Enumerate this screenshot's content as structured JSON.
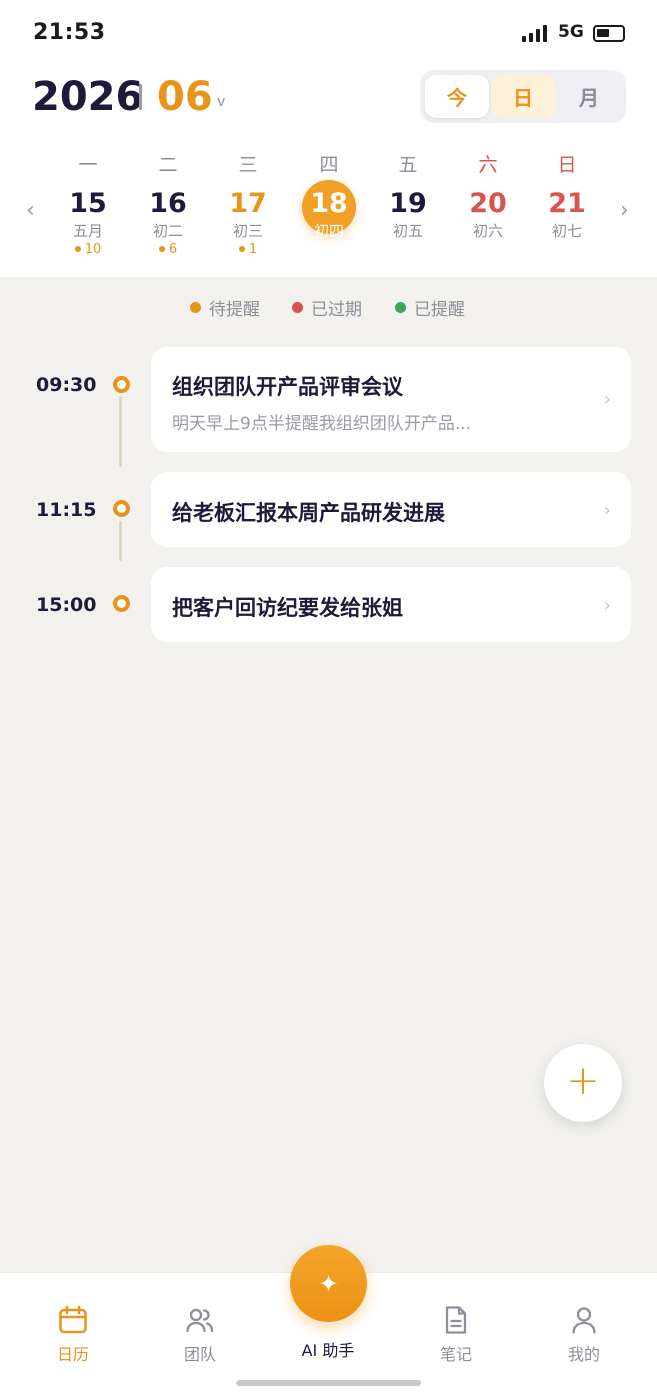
{
  "status_bar": {
    "time": "21:53",
    "network": "5G"
  },
  "header": {
    "year": "2026",
    "month": "06",
    "month_caret": "v",
    "view_options": [
      "今",
      "日",
      "月"
    ],
    "selected_view": "日"
  },
  "week": {
    "prev_arrow": "‹",
    "next_arrow": "›",
    "days": [
      {
        "weekday": "一",
        "date": "15",
        "lunar": "五月",
        "count": "10"
      },
      {
        "weekday": "二",
        "date": "16",
        "lunar": "初二",
        "count": "6"
      },
      {
        "weekday": "三",
        "date": "17",
        "lunar": "初三",
        "count": "1"
      },
      {
        "weekday": "四",
        "date": "18",
        "lunar": "初四",
        "count": ""
      },
      {
        "weekday": "五",
        "date": "19",
        "lunar": "初五",
        "count": ""
      },
      {
        "weekday": "六",
        "date": "20",
        "lunar": "初六",
        "count": ""
      },
      {
        "weekday": "日",
        "date": "21",
        "lunar": "初七",
        "count": ""
      }
    ],
    "selected_date": "18"
  },
  "legend": [
    {
      "label": "待提醒",
      "color": "#e8941a"
    },
    {
      "label": "已过期",
      "color": "#d9534f"
    },
    {
      "label": "已提醒",
      "color": "#3aa757"
    }
  ],
  "events": [
    {
      "time": "09:30",
      "title": "组织团队开产品评审会议",
      "subtitle": "明天早上9点半提醒我组织团队开产品..."
    },
    {
      "time": "11:15",
      "title": "给老板汇报本周产品研发进展",
      "subtitle": ""
    },
    {
      "time": "15:00",
      "title": "把客户回访纪要发给张姐",
      "subtitle": ""
    }
  ],
  "fab": {
    "label": "+"
  },
  "tabbar": {
    "tabs": [
      {
        "label": "日历",
        "icon": "calendar-icon"
      },
      {
        "label": "团队",
        "icon": "team-icon"
      },
      {
        "label": "AI 助手",
        "icon": "sparkle-icon"
      },
      {
        "label": "笔记",
        "icon": "note-icon"
      },
      {
        "label": "我的",
        "icon": "profile-icon"
      }
    ],
    "active": "日历"
  },
  "colors": {
    "accent": "#e8941a",
    "weekend": "#d9534f",
    "text": "#1d1a3a"
  }
}
